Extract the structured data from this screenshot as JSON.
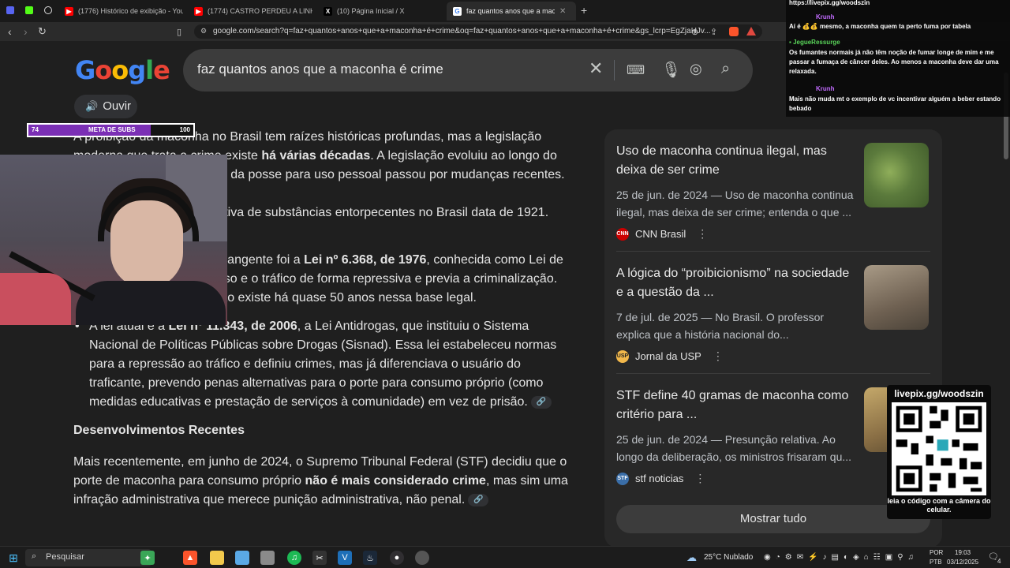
{
  "browser": {
    "tabs": [
      {
        "label": "(1776) Histórico de exibição - YouTube",
        "fav_color": "#ff0000"
      },
      {
        "label": "(1774) CASTRO PERDEU A LINHA EM...",
        "fav_color": "#ff0000"
      },
      {
        "label": "(10) Página Inicial / X",
        "fav_color": "#000000",
        "fav_glyph": "X"
      },
      {
        "label": "faz quantos anos que a maconha...",
        "fav_color": "#ffffff",
        "fav_glyph": "G"
      }
    ],
    "new_tab": "+",
    "url": "google.com/search?q=faz+quantos+anos+que+a+maconha+é+crime&oq=faz+quantos+anos+que+a+maconha+é+crime&gs_lcrp=EgZjaHJv..."
  },
  "google": {
    "query": "faz quantos anos que a maconha é crime",
    "ouvir_label": "Ouvir",
    "article": {
      "p1_a": "A proibição da maconha no Brasil tem raízes históricas profundas, mas a legislação moderna que trata a ",
      "p1_b": "crime existe ",
      "p1_bold": "há várias décadas",
      "p1_c": ". A legislação evoluiu ao longo do tempo, e o tratamento legal da posse para uso pessoal passou por mudanças recentes.",
      "p2": "A primeira legislação proibitiva de substâncias entorpecentes no Brasil data de 1921.",
      "b1_a": "Uma legislação mais abrangente foi a ",
      "b1_bold": "Lei nº 6.368, de 1976",
      "b1_b": ", conhecida como Lei de Tóxicos, que tratava o uso e o tráfico de forma repressiva e previa a criminalização. Portanto, a criminalização existe há quase 50 anos nessa base legal.",
      "b2_a": "A lei atual é a ",
      "b2_bold": "Lei nº 11.343, de 2006",
      "b2_b": ", a Lei Antidrogas, que instituiu o Sistema Nacional de Políticas Públicas sobre Drogas (Sisnad). Essa lei estabeleceu normas para a repressão ao tráfico e definiu crimes, mas já diferenciava o usuário do traficante, prevendo penas alternativas para o porte para consumo próprio (como medidas educativas e prestação de serviços à comunidade) em vez de prisão.",
      "heading": "Desenvolvimentos Recentes",
      "p3_a": "Mais recentemente, em junho de 2024, o Supremo Tribunal Federal (STF) decidiu que o porte de maconha para consumo próprio ",
      "p3_bold": "não é mais considerado crime",
      "p3_b": ", mas sim uma infração administrativa que merece punição administrativa, não penal."
    },
    "sources": [
      {
        "title": "Uso de maconha continua ilegal, mas deixa de ser crime",
        "snippet": "25 de jun. de 2024 — Uso de maconha continua ilegal, mas deixa de ser crime; entenda o que ...",
        "source": "CNN Brasil",
        "icon_color": "#cc0000",
        "icon_text": "CNN",
        "thumb_color": "#5b7a3c"
      },
      {
        "title": "A lógica do “proibicionismo” na sociedade e a questão da ...",
        "snippet": "7 de jul. de 2025 — No Brasil. O professor explica que a história nacional do...",
        "source": "Jornal da USP",
        "icon_color": "#f2b84b",
        "icon_text": "USP",
        "thumb_color": "#8a7a68"
      },
      {
        "title": "STF define 40 gramas de maconha como critério para ...",
        "snippet": "25 de jun. de 2024 — Presunção relativa. Ao longo da deliberação, os ministros frisaram qu...",
        "source": "stf noticias",
        "icon_color": "#3a6ea8",
        "icon_text": "STF",
        "thumb_color": "#a08a5a"
      }
    ],
    "show_all": "Mostrar tudo"
  },
  "overlay": {
    "subs_current": "74",
    "subs_label": "META DE SUBS",
    "subs_goal": "100",
    "subs_fraction": 0.74,
    "chat_url": "https://livepix.gg/woodszin",
    "chat": [
      {
        "name": "Krunh",
        "text": "Aí é 💰💰 mesmo, a maconha quem ta perto fuma por tabela",
        "color": "#c26bff"
      },
      {
        "name": "JegueRessurge",
        "text": "Os fumantes normais já não têm noção de fumar longe de mim e me passar a fumaça de câncer deles. Ao menos a maconha deve dar uma relaxada.",
        "color": "#5ad65a"
      },
      {
        "name": "Krunh",
        "text": "Mais não muda mt o exemplo de vc incentivar alguém a beber estando bebado",
        "color": "#c26bff"
      }
    ],
    "qr_title": "livepix.gg/woodszin",
    "qr_caption": "leia o código com a câmera do celular."
  },
  "taskbar": {
    "search_placeholder": "Pesquisar",
    "weather": "25°C  Nublado",
    "lang": "POR",
    "lang2": "PTB",
    "time": "19:03",
    "date": "03/12/2025",
    "notif_count": "4"
  }
}
